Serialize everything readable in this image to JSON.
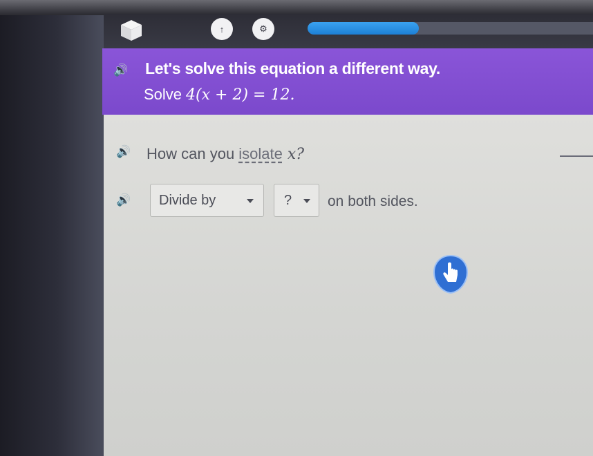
{
  "header": {
    "cube_icon": "cube-icon",
    "btn_a_icon": "person-icon",
    "btn_a_glyph": "↑",
    "btn_b_icon": "gear-icon",
    "btn_b_glyph": "⚙",
    "progress_fraction": 0.39,
    "progress_color": "#2a8fe5"
  },
  "banner": {
    "speaker_icon": "speaker-icon",
    "speaker_glyph": "🔊",
    "line1": "Let's solve this equation a different way.",
    "line2_prefix": "Solve",
    "equation": "4(x + 2) = 12.",
    "color": "#7f4dd1"
  },
  "question": {
    "speaker_glyph": "🔊",
    "prefix": "How can you ",
    "link": "isolate",
    "variable": " x?",
    "suffix": ""
  },
  "answer": {
    "speaker_glyph": "🔊",
    "dropdown1_value": "Divide by",
    "dropdown2_value": "?",
    "suffix": "on both sides."
  },
  "cursor": {
    "icon": "hand-pointer-icon",
    "color": "#2f6fd3"
  }
}
